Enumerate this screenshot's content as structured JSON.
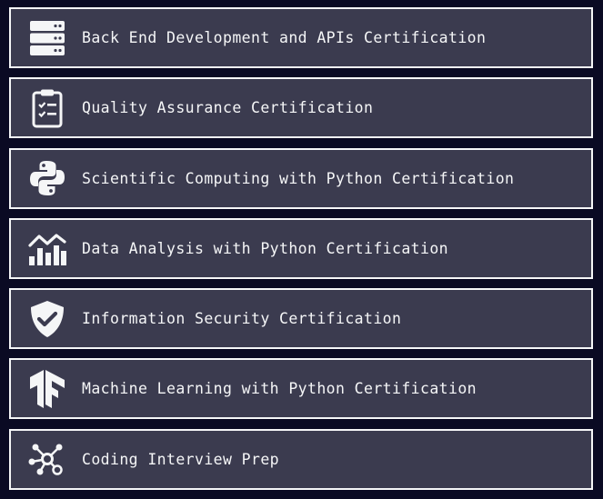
{
  "certifications": [
    {
      "label": "Back End Development and APIs Certification",
      "icon": "server-icon"
    },
    {
      "label": "Quality Assurance Certification",
      "icon": "clipboard-checklist-icon"
    },
    {
      "label": "Scientific Computing with Python Certification",
      "icon": "python-icon"
    },
    {
      "label": "Data Analysis with Python Certification",
      "icon": "chart-trend-icon"
    },
    {
      "label": "Information Security Certification",
      "icon": "shield-check-icon"
    },
    {
      "label": "Machine Learning with Python Certification",
      "icon": "tensorflow-icon"
    },
    {
      "label": "Coding Interview Prep",
      "icon": "algorithm-nodes-icon"
    }
  ],
  "colors": {
    "page_background": "#0a0a23",
    "item_background": "#3b3b4f",
    "item_border": "#f5f6f7",
    "text": "#f5f6f7"
  }
}
